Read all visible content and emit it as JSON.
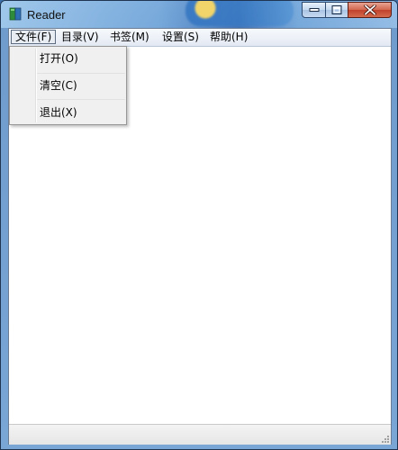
{
  "window": {
    "title": "Reader"
  },
  "menubar": [
    {
      "label": "文件(F)"
    },
    {
      "label": "目录(V)"
    },
    {
      "label": "书签(M)"
    },
    {
      "label": "设置(S)"
    },
    {
      "label": "帮助(H)"
    }
  ],
  "file_menu": {
    "items": [
      {
        "label": "打开(O)"
      },
      {
        "label": "清空(C)"
      },
      {
        "label": "退出(X)"
      }
    ]
  },
  "colors": {
    "titlebar_glass": "#7fa9d6",
    "close_button": "#c0412b",
    "menu_bg": "#f0f0f0"
  },
  "icons": {
    "app": "book-icon",
    "minimize": "minimize-icon",
    "maximize": "maximize-icon",
    "close": "close-icon",
    "grip": "resize-grip-icon"
  }
}
